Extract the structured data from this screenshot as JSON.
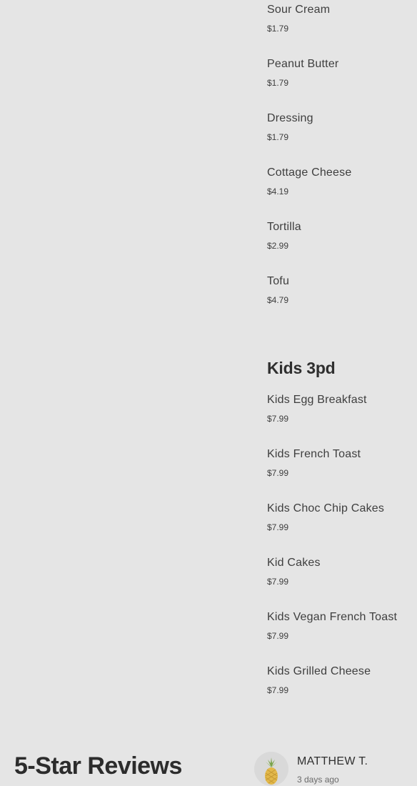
{
  "addons": [
    {
      "name": "Sour Cream",
      "price": "$1.79"
    },
    {
      "name": "Peanut Butter",
      "price": "$1.79"
    },
    {
      "name": "Dressing",
      "price": "$1.79"
    },
    {
      "name": "Cottage Cheese",
      "price": "$4.19"
    },
    {
      "name": "Tortilla",
      "price": "$2.99"
    },
    {
      "name": "Tofu",
      "price": "$4.79"
    }
  ],
  "kids_section": {
    "title": "Kids 3pd",
    "items": [
      {
        "name": "Kids Egg Breakfast",
        "price": "$7.99"
      },
      {
        "name": "Kids French Toast",
        "price": "$7.99"
      },
      {
        "name": "Kids Choc Chip Cakes",
        "price": "$7.99"
      },
      {
        "name": "Kid Cakes",
        "price": "$7.99"
      },
      {
        "name": "Kids Vegan French Toast",
        "price": "$7.99"
      },
      {
        "name": "Kids Grilled Cheese",
        "price": "$7.99"
      }
    ]
  },
  "reviews": {
    "heading": "5-Star Reviews",
    "first": {
      "name": "MATTHEW T.",
      "time": "3 days ago",
      "avatar_icon": "pineapple-icon"
    }
  },
  "colors": {
    "background": "#e5e5e5",
    "text": "#3e3e3e"
  }
}
